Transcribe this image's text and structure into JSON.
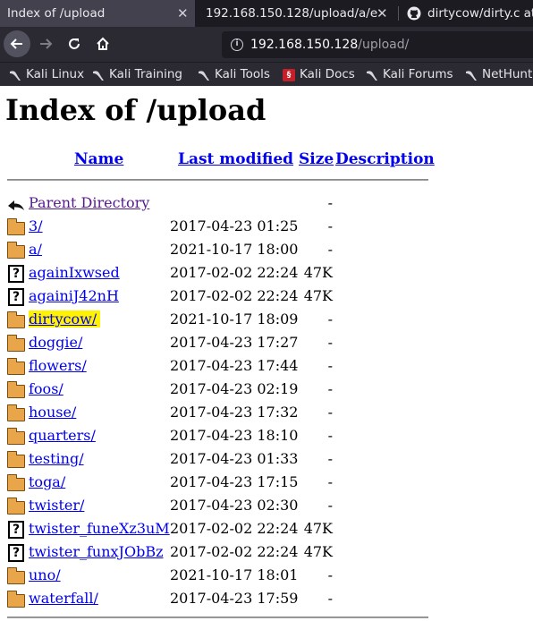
{
  "browser": {
    "tabs": [
      {
        "title": "Index of /upload",
        "active": true
      },
      {
        "title": "192.168.150.128/upload/a/e",
        "active": false
      },
      {
        "title": "dirtycow/dirty.c at",
        "active": false
      }
    ],
    "url_host": "192.168.150.128",
    "url_path": "/upload/",
    "bookmarks": [
      "Kali Linux",
      "Kali Training",
      "Kali Tools",
      "Kali Docs",
      "Kali Forums",
      "NetHunt"
    ]
  },
  "page": {
    "title": "Index of /upload",
    "columns": {
      "name": "Name",
      "last_modified": "Last modified",
      "size": "Size",
      "description": "Description"
    },
    "entries": [
      {
        "name": "Parent Directory",
        "date": "",
        "size": "-",
        "type": "parent"
      },
      {
        "name": "3/",
        "date": "2017-04-23 01:25",
        "size": "-",
        "type": "folder"
      },
      {
        "name": "a/",
        "date": "2021-10-17 18:00",
        "size": "-",
        "type": "folder"
      },
      {
        "name": "againIxwsed",
        "date": "2017-02-02 22:24",
        "size": "47K",
        "type": "file"
      },
      {
        "name": "againiJ42nH",
        "date": "2017-02-02 22:24",
        "size": "47K",
        "type": "file"
      },
      {
        "name": "dirtycow/",
        "date": "2021-10-17 18:09",
        "size": "-",
        "type": "folder"
      },
      {
        "name": "doggie/",
        "date": "2017-04-23 17:27",
        "size": "-",
        "type": "folder"
      },
      {
        "name": "flowers/",
        "date": "2017-04-23 17:44",
        "size": "-",
        "type": "folder"
      },
      {
        "name": "foos/",
        "date": "2017-04-23 02:19",
        "size": "-",
        "type": "folder"
      },
      {
        "name": "house/",
        "date": "2017-04-23 17:32",
        "size": "-",
        "type": "folder"
      },
      {
        "name": "quarters/",
        "date": "2017-04-23 18:10",
        "size": "-",
        "type": "folder"
      },
      {
        "name": "testing/",
        "date": "2017-04-23 01:33",
        "size": "-",
        "type": "folder"
      },
      {
        "name": "toga/",
        "date": "2017-04-23 17:15",
        "size": "-",
        "type": "folder"
      },
      {
        "name": "twister/",
        "date": "2017-04-23 02:30",
        "size": "-",
        "type": "folder"
      },
      {
        "name": "twister_funeXz3uM",
        "date": "2017-02-02 22:24",
        "size": "47K",
        "type": "file"
      },
      {
        "name": "twister_funxJObBz",
        "date": "2017-02-02 22:24",
        "size": "47K",
        "type": "file"
      },
      {
        "name": "uno/",
        "date": "2021-10-17 18:01",
        "size": "-",
        "type": "folder"
      },
      {
        "name": "waterfall/",
        "date": "2017-04-23 17:59",
        "size": "-",
        "type": "folder"
      }
    ]
  },
  "colors": {
    "link": "#0000ee",
    "visited": "#551a8b",
    "highlight": "#fff200"
  }
}
